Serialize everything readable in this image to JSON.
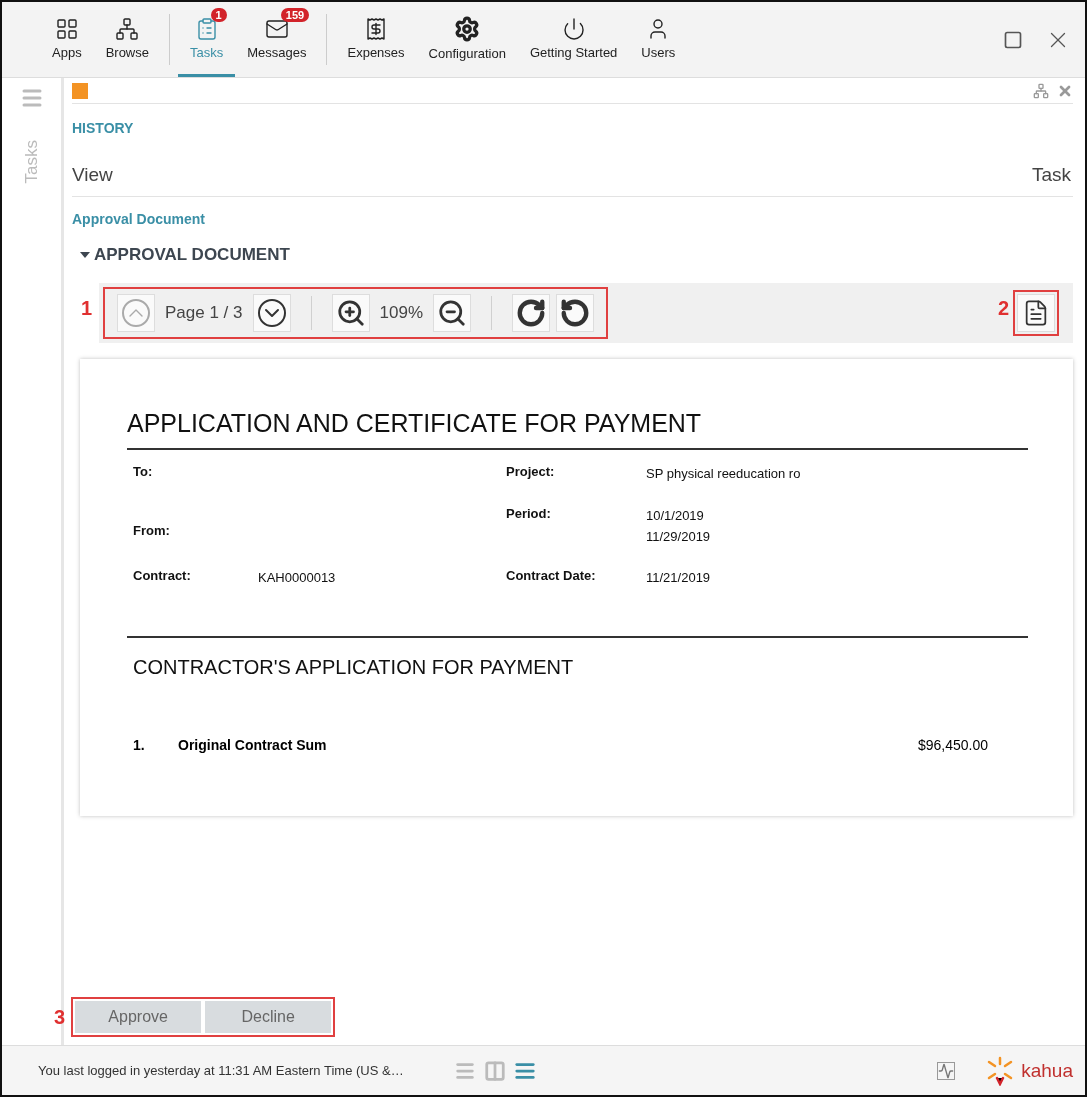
{
  "nav": {
    "items": [
      {
        "kind": "apps",
        "label": "Apps",
        "selected": false
      },
      {
        "kind": "browse",
        "label": "Browse",
        "selected": false
      },
      {
        "kind": "tasks",
        "label": "Tasks",
        "selected": true,
        "badge": "1"
      },
      {
        "kind": "messages",
        "label": "Messages",
        "selected": false,
        "badge": "159"
      },
      {
        "kind": "expenses",
        "label": "Expenses",
        "selected": false
      },
      {
        "kind": "configuration",
        "label": "Configuration",
        "selected": false
      },
      {
        "kind": "getting_started",
        "label": "Getting Started",
        "selected": false
      },
      {
        "kind": "users",
        "label": "Users",
        "selected": false
      }
    ]
  },
  "sidebar": {
    "label": "Tasks"
  },
  "breadcrumb": "HISTORY",
  "header": {
    "left": "View",
    "right": "Task"
  },
  "section_link": "Approval Document",
  "section": {
    "title": "APPROVAL DOCUMENT",
    "expanded": true
  },
  "viewer": {
    "page": "Page 1 / 3",
    "zoom": "109%",
    "annotations": [
      "1",
      "2"
    ]
  },
  "document": {
    "title": "APPLICATION AND CERTIFICATE FOR PAYMENT",
    "fields": [
      {
        "label": "To:",
        "label_2": "Project:",
        "value_2": [
          "SP physical reeducation ro"
        ]
      },
      {
        "label": "From:",
        "label_2": "Period:",
        "value_2": [
          "10/1/2019",
          "11/29/2019"
        ]
      },
      {
        "label": "Contract:",
        "value": "KAH0000013",
        "label_2": "Contract Date:",
        "value_2": [
          "11/21/2019"
        ]
      }
    ],
    "section_title": "CONTRACTOR'S APPLICATION FOR PAYMENT",
    "items": [
      {
        "number": "1.",
        "label": "Original Contract Sum",
        "amount": "$96,450.00"
      }
    ]
  },
  "actions": {
    "annotation": "3",
    "buttons": [
      "Approve",
      "Decline"
    ]
  },
  "status_bar": {
    "message": "You last logged in yesterday at 11:31 AM Eastern Time (US &…",
    "view_modes": [
      {
        "kind": "rows",
        "selected": false
      },
      {
        "kind": "columns",
        "selected": false
      },
      {
        "kind": "list",
        "selected": true
      }
    ],
    "brand": "kahua"
  }
}
